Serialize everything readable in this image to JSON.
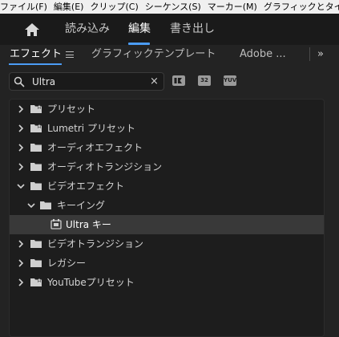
{
  "menubar": [
    "ファイル(F)",
    "編集(E)",
    "クリップ(C)",
    "シーケンス(S)",
    "マーカー(M)",
    "グラフィックとタイトル(G"
  ],
  "workspace": {
    "tabs": [
      "読み込み",
      "編集",
      "書き出し"
    ],
    "active_tab": "編集"
  },
  "panel": {
    "tabs": [
      "エフェクト",
      "グラフィックテンプレート",
      "Adobe ..."
    ],
    "active_tab": "エフェクト",
    "overflow": "»"
  },
  "search": {
    "value": "Ultra",
    "clear": "×"
  },
  "filters": [
    "32",
    "YUV"
  ],
  "tree": [
    {
      "label": "プリセット",
      "expanded": false,
      "icon": "preset-folder-icon"
    },
    {
      "label": "Lumetri プリセット",
      "expanded": false,
      "icon": "preset-folder-icon"
    },
    {
      "label": "オーディオエフェクト",
      "expanded": false,
      "icon": "folder-icon"
    },
    {
      "label": "オーディオトランジション",
      "expanded": false,
      "icon": "folder-icon"
    },
    {
      "label": "ビデオエフェクト",
      "expanded": true,
      "icon": "folder-icon"
    },
    {
      "label": "キーイング",
      "expanded": true,
      "icon": "folder-icon"
    },
    {
      "label": "Ultra キー",
      "expanded": false,
      "icon": "effect-icon",
      "selected": true
    },
    {
      "label": "ビデオトランジション",
      "expanded": false,
      "icon": "folder-icon"
    },
    {
      "label": "レガシー",
      "expanded": false,
      "icon": "folder-icon"
    },
    {
      "label": "YouTubeプリセット",
      "expanded": false,
      "icon": "preset-folder-icon"
    }
  ],
  "colors": {
    "accent": "#4b9cf5",
    "panel_bg": "#232323",
    "selected_row": "#393939"
  }
}
